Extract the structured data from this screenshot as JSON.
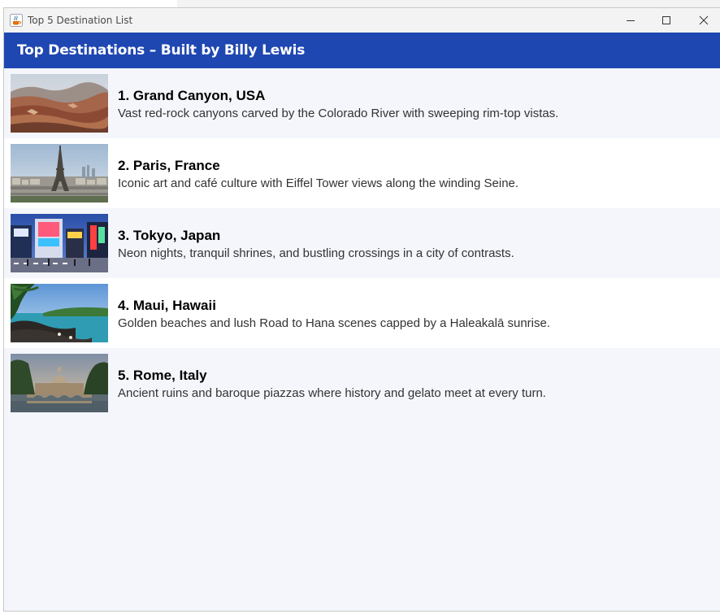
{
  "window": {
    "title": "Top 5 Destination List",
    "icon": "java-cup-icon"
  },
  "header": {
    "title": "Top Destinations – Built by Billy Lewis",
    "color": "#1f47b1"
  },
  "destinations": [
    {
      "title": "1. Grand Canyon, USA",
      "description": "Vast red-rock canyons carved by the Colorado River with sweeping rim-top vistas.",
      "image": "grand-canyon-photo"
    },
    {
      "title": "2. Paris, France",
      "description": "Iconic art and café culture with Eiffel Tower views along the winding Seine.",
      "image": "paris-photo"
    },
    {
      "title": "3. Tokyo, Japan",
      "description": "Neon nights, tranquil shrines, and bustling crossings in a city of contrasts.",
      "image": "tokyo-photo"
    },
    {
      "title": "4. Maui, Hawaii",
      "description": "Golden beaches and lush Road to Hana scenes capped by a Haleakalā sunrise.",
      "image": "maui-photo"
    },
    {
      "title": "5. Rome, Italy",
      "description": "Ancient ruins and baroque piazzas where history and gelato meet at every turn.",
      "image": "rome-photo"
    }
  ]
}
